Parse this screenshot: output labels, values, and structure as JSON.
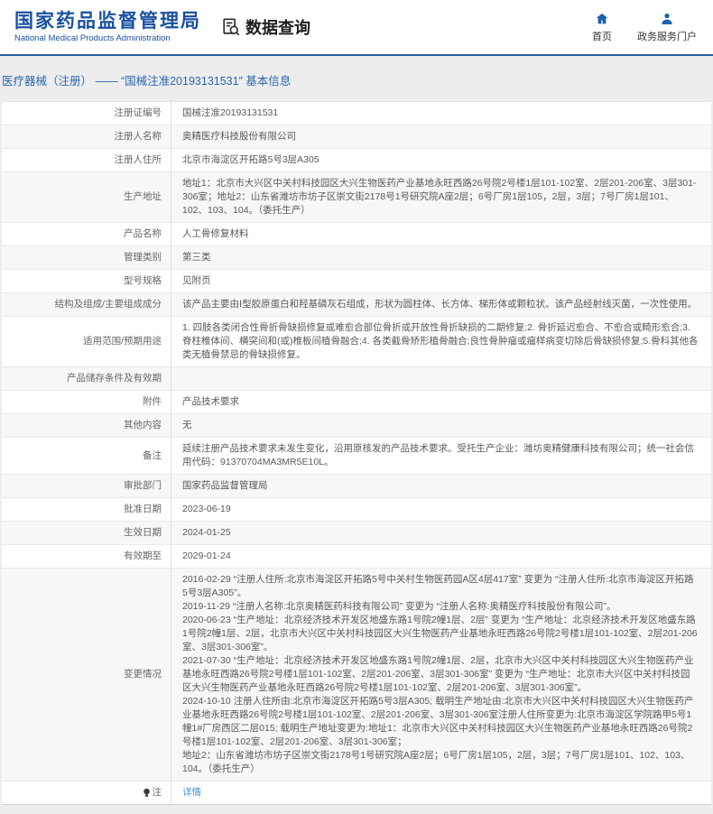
{
  "colors": {
    "brand_blue": "#1950a0",
    "header_border_blue": "#2c5e9e",
    "breadcrumb_blue": "#2a66ad",
    "link_blue": "#4193de"
  },
  "icons": {
    "app": "document-search-icon",
    "home": "home-icon",
    "portal": "user-icon",
    "note": "bulb-icon"
  },
  "header": {
    "logo": {
      "title": "国家药品监督管理局",
      "subtitle": "National Medical Products Administration"
    },
    "app_title": "数据查询",
    "nav": [
      {
        "label": "首页"
      },
      {
        "label": "政务服务门户"
      }
    ]
  },
  "breadcrumb": {
    "text": "医疗器械（注册） —— “国械注准20193131531” 基本信息"
  },
  "table": {
    "rows": [
      {
        "label": "注册证编号",
        "value": "国械注准20193131531"
      },
      {
        "label": "注册人名称",
        "value": "奥精医疗科技股份有限公司"
      },
      {
        "label": "注册人住所",
        "value": "北京市海淀区开拓路5号3层A305"
      },
      {
        "label": "生产地址",
        "value": "地址1：北京市大兴区中关村科技园区大兴生物医药产业基地永旺西路26号院2号楼1层101-102室、2层201-206室、3层301-306室；地址2：山东省潍坊市坊子区崇文街2178号1号研究院A座2层；6号厂房1层105，2层，3层；7号厂房1层101、102、103、104。（委托生产）"
      },
      {
        "label": "产品名称",
        "value": "人工骨修复材料"
      },
      {
        "label": "管理类别",
        "value": "第三类"
      },
      {
        "label": "型号规格",
        "value": "见附页"
      },
      {
        "label": "结构及组成/主要组成成分",
        "value": "该产品主要由Ⅰ型胶原蛋白和羟基磷灰石组成，形状为圆柱体、长方体、梯形体或颗粒状。该产品经射线灭菌，一次性使用。"
      },
      {
        "label": "适用范围/预期用途",
        "value": "1. 四肢各类闭合性骨折骨缺损修复或难愈合部位骨折或开放性骨折缺损的二期修复;2. 骨折延迟愈合、不愈合或畸形愈合;3. 脊柱椎体间、横突间和(或)椎板间植骨融合;4. 各类截骨矫形植骨融合;良性骨肿瘤或瘤样病变切除后骨缺损修复;5.骨科其他各类无植骨禁忌的骨缺损修复。"
      },
      {
        "label": "产品储存条件及有效期",
        "value": ""
      },
      {
        "label": "附件",
        "value": "产品技术要求"
      },
      {
        "label": "其他内容",
        "value": "无"
      },
      {
        "label": "备注",
        "value": "延续注册产品技术要求未发生变化，沿用原核发的产品技术要求。受托生产企业：潍坊奥精健康科技有限公司；统一社会信用代码：91370704MA3MR5E10L。"
      },
      {
        "label": "审批部门",
        "value": "国家药品监督管理局"
      },
      {
        "label": "批准日期",
        "value": "2023-06-19"
      },
      {
        "label": "生效日期",
        "value": "2024-01-25"
      },
      {
        "label": "有效期至",
        "value": "2029-01-24"
      },
      {
        "label": "变更情况",
        "value": [
          "2016-02-29 “注册人住所:北京市海淀区开拓路5号中关村生物医药园A区4层417室” 变更为 “注册人住所:北京市海淀区开拓路5号3层A305”。",
          "2019-11-29 “注册人名称:北京奥精医药科技有限公司” 变更为 “注册人名称:奥精医疗科技股份有限公司”。",
          "2020-06-23 “生产地址：北京经济技术开发区地盛东路1号院2幢1层、2层” 变更为 “生产地址：北京经济技术开发区地盛东路1号院2幢1层、2层，北京市大兴区中关村科技园区大兴生物医药产业基地永旺西路26号院2号楼1层101-102室、2层201-206室、3层301-306室”。",
          "2021-07-30 “生产地址：北京经济技术开发区地盛东路1号院2幢1层、2层，北京市大兴区中关村科技园区大兴生物医药产业基地永旺西路26号院2号楼1层101-102室、2层201-206室、3层301-306室” 变更为 “生产地址：北京市大兴区中关村科技园区大兴生物医药产业基地永旺西路26号院2号楼1层101-102室、2层201-206室、3层301-306室”。",
          "2024-10-10 注册人住所由:北京市海淀区开拓路5号3层A305; 载明生产地址由:北京市大兴区中关村科技园区大兴生物医药产业基地永旺西路26号院2号楼1层101-102室、2层201-206室、3层301-306室注册人住所变更为:北京市海淀区学院路甲5号1幢1#厂房西区二层015; 载明生产地址变更为:地址1：北京市大兴区中关村科技园区大兴生物医药产业基地永旺西路26号院2号楼1层101-102室、2层201-206室、3层301-306室；",
          "地址2：山东省潍坊市坊子区崇文街2178号1号研究院A座2层；6号厂房1层105，2层，3层；7号厂房1层101、102、103、104。（委托生产）"
        ]
      },
      {
        "label": "注",
        "value": "详情"
      }
    ]
  }
}
